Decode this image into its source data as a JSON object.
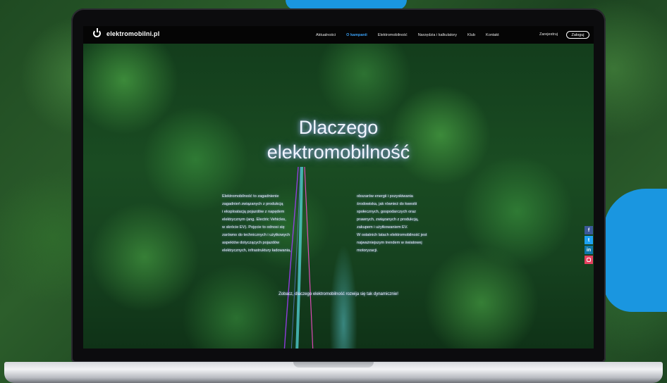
{
  "site": {
    "logo_text": "elektromobilni.pl"
  },
  "nav": {
    "items": [
      {
        "label": "Aktualności",
        "active": false
      },
      {
        "label": "O kampanii",
        "active": true
      },
      {
        "label": "Elektromobilność",
        "active": false
      },
      {
        "label": "Narzędzia i kalkulatory",
        "active": false
      },
      {
        "label": "Klub",
        "active": false
      },
      {
        "label": "Kontakt",
        "active": false
      }
    ],
    "register_label": "Zarejestruj",
    "login_label": "Zaloguj"
  },
  "hero": {
    "title_line1": "Dlaczego",
    "title_line2": "elektromobilność",
    "left_column": [
      "Elektromobilność to zagadnienie",
      "zagadnień związanych z produkcją",
      "i eksploatacją pojazdów z napędem",
      "elektrycznym (ang. Electric Vehicles,",
      "w skrócie EV). Pojęcie to odnosi się",
      "zarówno do technicznych i użytkowych",
      "aspektów dotyczących pojazdów",
      "elektrycznych, infrastruktury ładowania,"
    ],
    "right_column": [
      "obszarów energii i pozyskiwania",
      "środowiska, jak również do kwestii",
      "społecznych, gospodarczych oraz",
      "prawnych, związanych z produkcją,",
      "zakupem i użytkowaniem EV.",
      "W ostatnich latach elektromobilność jest",
      "najważniejszym trendem w światowej",
      "motoryzacji."
    ],
    "cta": "Zobacz, dlaczego elektromobilność rozwija się tak dynamicznie!"
  },
  "social": [
    {
      "icon": "facebook-icon",
      "glyph": "f"
    },
    {
      "icon": "twitter-icon",
      "glyph": "t"
    },
    {
      "icon": "linkedin-icon",
      "glyph": "in"
    },
    {
      "icon": "instagram-icon",
      "glyph": ""
    }
  ],
  "colors": {
    "accent_blue": "#1a96e0",
    "nav_active": "#3aa0f5",
    "navbar_bg": "#050505"
  }
}
